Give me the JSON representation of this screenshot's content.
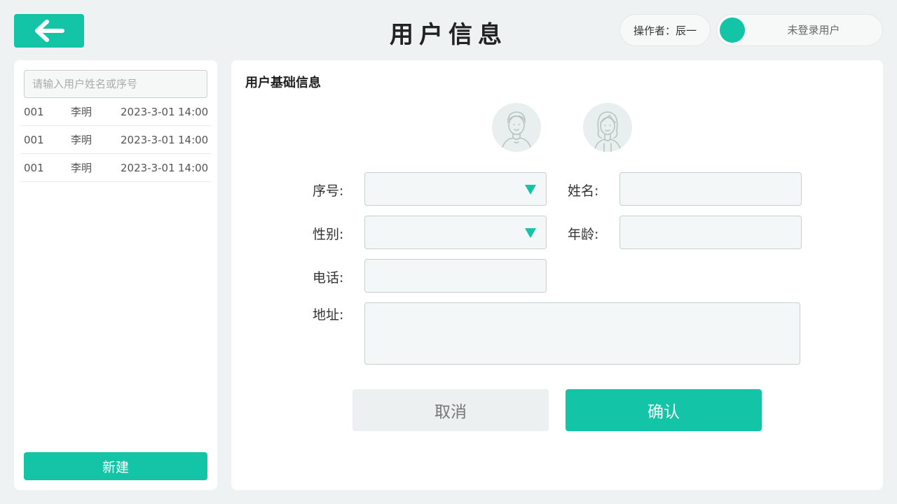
{
  "header": {
    "title": "用户信息",
    "operator_label": "操作者：辰一",
    "login_status": "未登录用户"
  },
  "sidebar": {
    "search_placeholder": "请输入用户姓名或序号",
    "rows": [
      {
        "id": "001",
        "name": "李明",
        "date": "2023-3-01",
        "time": "14:00"
      },
      {
        "id": "001",
        "name": "李明",
        "date": "2023-3-01",
        "time": "14:00"
      },
      {
        "id": "001",
        "name": "李明",
        "date": "2023-3-01",
        "time": "14:00"
      }
    ],
    "new_label": "新建"
  },
  "form": {
    "section_title": "用户基础信息",
    "labels": {
      "serial": "序号:",
      "name": "姓名:",
      "gender": "性别:",
      "age": "年龄:",
      "phone": "电话:",
      "address": "地址:"
    },
    "cancel_label": "取消",
    "confirm_label": "确认"
  },
  "colors": {
    "accent": "#14c4a6",
    "background": "#eef2f3"
  }
}
